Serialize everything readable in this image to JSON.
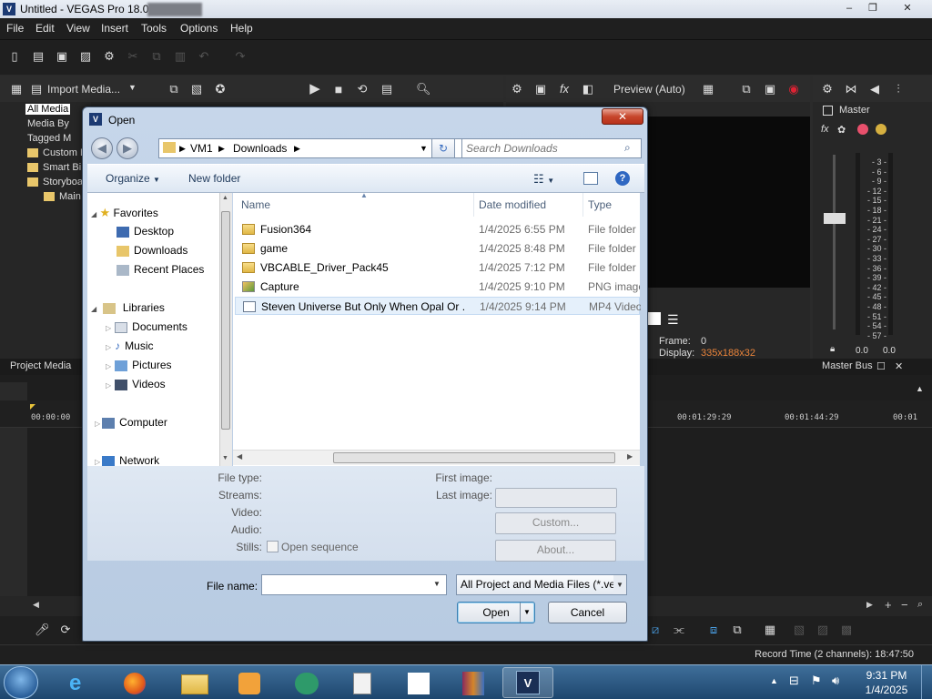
{
  "window": {
    "title": "Untitled - VEGAS Pro 18.0",
    "icon_letter": "V"
  },
  "menu": [
    "File",
    "Edit",
    "View",
    "Insert",
    "Tools",
    "Options",
    "Help"
  ],
  "project_media": {
    "import_label": "Import Media...",
    "tree": [
      "All Media",
      "Media By",
      "Tagged M",
      "Custom B",
      "Smart Bi",
      "Storyboa",
      "Main"
    ]
  },
  "preview": {
    "mode": "Preview (Auto)",
    "frame_label": "Frame:",
    "frame_value": "0",
    "display_label": "Display:",
    "display_value": "335x188x32"
  },
  "master": {
    "title": "Master",
    "meter_scale": [
      "3",
      "6",
      "9",
      "12",
      "15",
      "18",
      "21",
      "24",
      "27",
      "30",
      "33",
      "36",
      "39",
      "42",
      "45",
      "48",
      "51",
      "54",
      "57"
    ],
    "left_value": "0.0",
    "right_value": "0.0"
  },
  "tabs": {
    "project_media": "Project Media",
    "master_bus": "Master Bus"
  },
  "timeline": {
    "start": "00:00:00",
    "tc2": "00:01:29:29",
    "tc3": "00:01:44:29",
    "tc4": "00:01"
  },
  "status": {
    "record_time": "Record Time (2 channels): 18:47:50"
  },
  "dialog": {
    "title": "Open",
    "breadcrumb": [
      "VM1",
      "Downloads"
    ],
    "search_placeholder": "Search Downloads",
    "organize": "Organize",
    "new_folder": "New folder",
    "nav": {
      "favorites": "Favorites",
      "favorites_items": [
        "Desktop",
        "Downloads",
        "Recent Places"
      ],
      "libraries": "Libraries",
      "libraries_items": [
        "Documents",
        "Music",
        "Pictures",
        "Videos"
      ],
      "computer": "Computer",
      "network": "Network"
    },
    "columns": {
      "name": "Name",
      "date": "Date modified",
      "type": "Type"
    },
    "files": [
      {
        "name": "Fusion364",
        "date": "1/4/2025 6:55 PM",
        "type": "File folder",
        "kind": "folder"
      },
      {
        "name": "game",
        "date": "1/4/2025 8:48 PM",
        "type": "File folder",
        "kind": "folder"
      },
      {
        "name": "VBCABLE_Driver_Pack45",
        "date": "1/4/2025 7:12 PM",
        "type": "File folder",
        "kind": "folder"
      },
      {
        "name": "Capture",
        "date": "1/4/2025 9:10 PM",
        "type": "PNG image",
        "kind": "image"
      },
      {
        "name": "Steven Universe But Only When Opal Or ...",
        "date": "1/4/2025 9:14 PM",
        "type": "MP4 Video",
        "kind": "video"
      }
    ],
    "props": {
      "file_type": "File type:",
      "streams": "Streams:",
      "video": "Video:",
      "audio": "Audio:",
      "stills": "Stills:",
      "open_sequence": "Open sequence",
      "first_image": "First image:",
      "last_image": "Last image:",
      "custom": "Custom...",
      "about": "About..."
    },
    "file_name_label": "File name:",
    "file_name_value": "",
    "file_type_filter": "All Project and Media Files (*.veg",
    "open_button": "Open",
    "cancel_button": "Cancel"
  },
  "taskbar": {
    "time": "9:31 PM",
    "date": "1/4/2025"
  }
}
